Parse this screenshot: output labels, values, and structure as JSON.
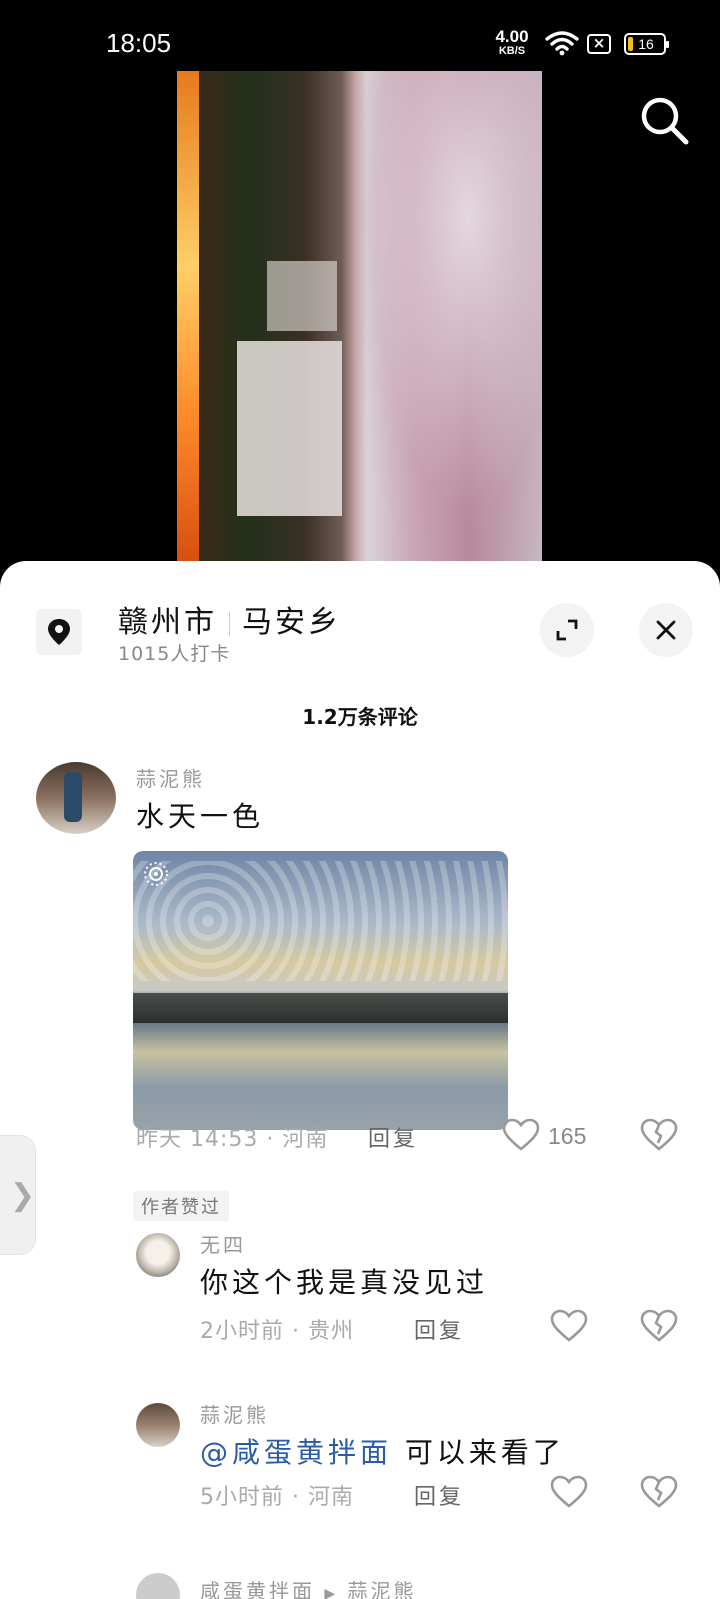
{
  "status_bar": {
    "time": "18:05",
    "net_speed_value": "4.00",
    "net_speed_unit": "KB/S",
    "x_glyph": "×",
    "battery": "16",
    "icons": [
      "wifi-icon",
      "no-sim-icon",
      "battery-icon"
    ]
  },
  "video": {
    "search_icon": "search-icon"
  },
  "location": {
    "city": "赣州市",
    "town": "马安乡",
    "checkins": "1015人打卡",
    "icons": [
      "location-pin-icon",
      "expand-icon",
      "close-icon"
    ]
  },
  "comments_header": "1.2万条评论",
  "comments": [
    {
      "user": "蒜泥熊",
      "text": "水天一色",
      "meta": "昨天 14:53 · 河南",
      "reply_label": "回复",
      "likes": "165",
      "badge": "作者赞过"
    },
    {
      "user": "无四",
      "text": "你这个我是真没见过",
      "meta": "2小时前 · 贵州",
      "reply_label": "回复"
    },
    {
      "user": "蒜泥熊",
      "mention": "@咸蛋黄拌面",
      "text": " 可以来看了",
      "meta": "5小时前 · 河南",
      "reply_label": "回复"
    },
    {
      "user": "咸蛋黄拌面",
      "reply_arrow": "▶",
      "reply_to": "蒜泥熊"
    }
  ],
  "side_handle": "❯",
  "colors": {
    "mention": "#2a5aa8",
    "battery_fill": "#f2c21b",
    "sheet_bg": "#ffffff",
    "screen_bg": "#000000"
  }
}
